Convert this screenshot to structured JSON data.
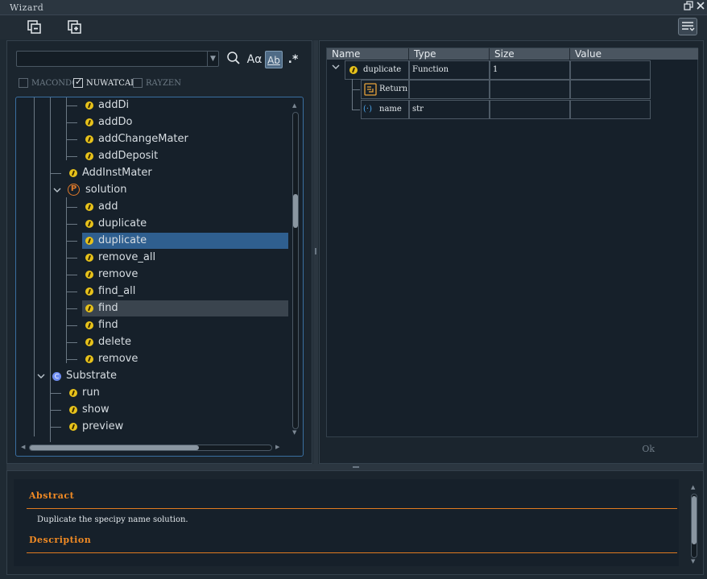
{
  "window": {
    "title": "Wizard"
  },
  "titlebar": {
    "restore_icon": "restore-window-icon",
    "close_icon": "close-icon"
  },
  "toolbar": {
    "icons": [
      "collapse-all-icon",
      "expand-all-icon",
      "panel-settings-icon"
    ]
  },
  "search": {
    "value": "",
    "placeholder": "",
    "options": {
      "match_case": "Aα",
      "whole_word": "Ab",
      "regex": ".*"
    }
  },
  "filters": [
    {
      "label": "MACONDO",
      "checked": false
    },
    {
      "label": "NUWATCAD",
      "checked": true
    },
    {
      "label": "RAYZEN",
      "checked": false
    }
  ],
  "tree": {
    "nodes": [
      {
        "label": "addDi",
        "kind": "function"
      },
      {
        "label": "addDo",
        "kind": "function"
      },
      {
        "label": "addChangeMater",
        "kind": "function"
      },
      {
        "label": "addDeposit",
        "kind": "function"
      },
      {
        "label": "AddInstMater",
        "kind": "function"
      },
      {
        "label": "solution",
        "kind": "package",
        "expanded": true
      },
      {
        "label": "add",
        "kind": "function"
      },
      {
        "label": "duplicate",
        "kind": "function"
      },
      {
        "label": "duplicate",
        "kind": "function",
        "selected": true
      },
      {
        "label": "remove_all",
        "kind": "function"
      },
      {
        "label": "remove",
        "kind": "function"
      },
      {
        "label": "find_all",
        "kind": "function"
      },
      {
        "label": "find",
        "kind": "function",
        "hovered": true
      },
      {
        "label": "find",
        "kind": "function"
      },
      {
        "label": "delete",
        "kind": "function"
      },
      {
        "label": "remove",
        "kind": "function"
      },
      {
        "label": "Substrate",
        "kind": "class",
        "expanded": true
      },
      {
        "label": "run",
        "kind": "function"
      },
      {
        "label": "show",
        "kind": "function"
      },
      {
        "label": "preview",
        "kind": "function"
      }
    ]
  },
  "properties": {
    "headers": [
      "Name",
      "Type",
      "Size",
      "Value"
    ],
    "rows": [
      {
        "name": "duplicate",
        "type": "Function",
        "size": "1",
        "value": "",
        "icon": "function-icon"
      },
      {
        "name": "Return",
        "type": "",
        "size": "",
        "value": "",
        "icon": "return-icon"
      },
      {
        "name": "name",
        "type": "str",
        "size": "",
        "value": "",
        "icon": "variable-icon"
      }
    ],
    "status": "Ok"
  },
  "doc": {
    "abstract_heading": "Abstract",
    "abstract_text": "Duplicate the specipy name solution.",
    "description_heading": "Description"
  },
  "colors": {
    "accent_orange": "#f08a24",
    "selection_blue": "#2f5f8f",
    "function_yellow": "#e7c21b",
    "tree_border": "#3a6fa1"
  }
}
